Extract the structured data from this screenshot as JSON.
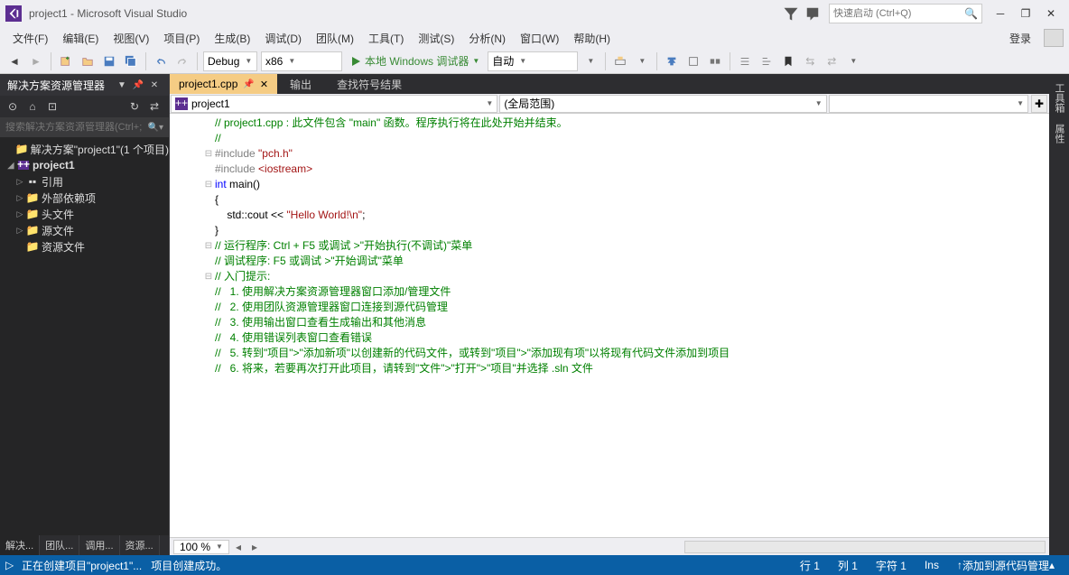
{
  "title": "project1 - Microsoft Visual Studio",
  "quicklaunch_placeholder": "快速启动 (Ctrl+Q)",
  "menu": [
    "文件(F)",
    "编辑(E)",
    "视图(V)",
    "项目(P)",
    "生成(B)",
    "调试(D)",
    "团队(M)",
    "工具(T)",
    "测试(S)",
    "分析(N)",
    "窗口(W)",
    "帮助(H)"
  ],
  "login": "登录",
  "toolbar": {
    "config": "Debug",
    "platform": "x86",
    "start": "本地 Windows 调试器",
    "auto": "自动"
  },
  "solution_explorer": {
    "title": "解决方案资源管理器",
    "search_placeholder": "搜索解决方案资源管理器(Ctrl+;",
    "solution": "解决方案\"project1\"(1 个项目)",
    "project": "project1",
    "nodes": [
      "引用",
      "外部依赖项",
      "头文件",
      "源文件",
      "资源文件"
    ]
  },
  "sidebar_tabs": [
    "解决...",
    "团队...",
    "调用...",
    "资源..."
  ],
  "doc_tabs": {
    "active": "project1.cpp",
    "output": "输出",
    "find": "查找符号结果"
  },
  "nav": {
    "left": "project1",
    "right": "(全局范围)"
  },
  "code_lines": [
    {
      "f": "",
      "c": [
        {
          "t": "// project1.cpp : 此文件包含 \"main\" 函数。程序执行将在此处开始并结束。",
          "s": "c-com"
        }
      ]
    },
    {
      "f": "",
      "c": [
        {
          "t": "//",
          "s": "c-com"
        }
      ]
    },
    {
      "f": "",
      "c": [
        {
          "t": "",
          "s": ""
        }
      ]
    },
    {
      "f": "⊟",
      "c": [
        {
          "t": "#include ",
          "s": "c-pp"
        },
        {
          "t": "\"pch.h\"",
          "s": "c-str"
        }
      ]
    },
    {
      "f": "",
      "c": [
        {
          "t": "#include ",
          "s": "c-pp"
        },
        {
          "t": "<iostream>",
          "s": "c-str"
        }
      ]
    },
    {
      "f": "",
      "c": [
        {
          "t": "",
          "s": ""
        }
      ]
    },
    {
      "f": "⊟",
      "c": [
        {
          "t": "int",
          "s": "c-kw"
        },
        {
          "t": " main()",
          "s": "c-txt"
        }
      ]
    },
    {
      "f": "",
      "c": [
        {
          "t": "{",
          "s": "c-txt"
        }
      ]
    },
    {
      "f": "",
      "c": [
        {
          "t": "    std::cout << ",
          "s": "c-txt"
        },
        {
          "t": "\"Hello World!\\n\"",
          "s": "c-str"
        },
        {
          "t": ";",
          "s": "c-txt"
        }
      ]
    },
    {
      "f": "",
      "c": [
        {
          "t": "}",
          "s": "c-txt"
        }
      ]
    },
    {
      "f": "",
      "c": [
        {
          "t": "",
          "s": ""
        }
      ]
    },
    {
      "f": "⊟",
      "c": [
        {
          "t": "// 运行程序: Ctrl + F5 或调试 >\"开始执行(不调试)\"菜单",
          "s": "c-com"
        }
      ]
    },
    {
      "f": "",
      "c": [
        {
          "t": "// 调试程序: F5 或调试 >\"开始调试\"菜单",
          "s": "c-com"
        }
      ]
    },
    {
      "f": "",
      "c": [
        {
          "t": "",
          "s": ""
        }
      ]
    },
    {
      "f": "⊟",
      "c": [
        {
          "t": "// 入门提示:",
          "s": "c-com"
        }
      ]
    },
    {
      "f": "",
      "c": [
        {
          "t": "//   1. 使用解决方案资源管理器窗口添加/管理文件",
          "s": "c-com"
        }
      ]
    },
    {
      "f": "",
      "c": [
        {
          "t": "//   2. 使用团队资源管理器窗口连接到源代码管理",
          "s": "c-com"
        }
      ]
    },
    {
      "f": "",
      "c": [
        {
          "t": "//   3. 使用输出窗口查看生成输出和其他消息",
          "s": "c-com"
        }
      ]
    },
    {
      "f": "",
      "c": [
        {
          "t": "//   4. 使用错误列表窗口查看错误",
          "s": "c-com"
        }
      ]
    },
    {
      "f": "",
      "c": [
        {
          "t": "//   5. 转到\"项目\">\"添加新项\"以创建新的代码文件，或转到\"项目\">\"添加现有项\"以将现有代码文件添加到项目",
          "s": "c-com"
        }
      ]
    },
    {
      "f": "",
      "c": [
        {
          "t": "//   6. 将来，若要再次打开此项目，请转到\"文件\">\"打开\">\"项目\"并选择 .sln 文件",
          "s": "c-com"
        }
      ]
    }
  ],
  "zoom": "100 %",
  "right_tabs": [
    "工具箱",
    "属性"
  ],
  "status": {
    "creating": "正在创建项目\"project1\"...",
    "success": "项目创建成功。",
    "line": "行 1",
    "col": "列 1",
    "char": "字符 1",
    "ins": "Ins",
    "scm": "添加到源代码管理"
  }
}
